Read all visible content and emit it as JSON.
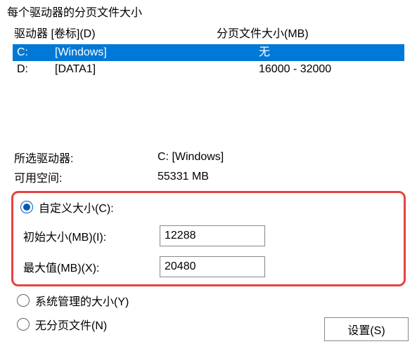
{
  "section_title": "每个驱动器的分页文件大小",
  "columns": {
    "drive_label": "驱动器 [卷标](D)",
    "pagefile_size": "分页文件大小(MB)"
  },
  "drives": [
    {
      "letter": "C:",
      "label": "[Windows]",
      "size": "无",
      "selected": true
    },
    {
      "letter": "D:",
      "label": "[DATA1]",
      "size": "16000 - 32000",
      "selected": false
    }
  ],
  "info": {
    "selected_drive_label": "所选驱动器:",
    "selected_drive_value": "C:  [Windows]",
    "free_space_label": "可用空间:",
    "free_space_value": "55331 MB"
  },
  "custom_size": {
    "radio_label": "自定义大小(C):",
    "initial_label": "初始大小(MB)(I):",
    "initial_value": "12288",
    "max_label": "最大值(MB)(X):",
    "max_value": "20480"
  },
  "other_options": {
    "system_managed_label": "系统管理的大小(Y)",
    "no_pagefile_label": "无分页文件(N)"
  },
  "set_button_label": "设置(S)",
  "selected_mode": "custom"
}
